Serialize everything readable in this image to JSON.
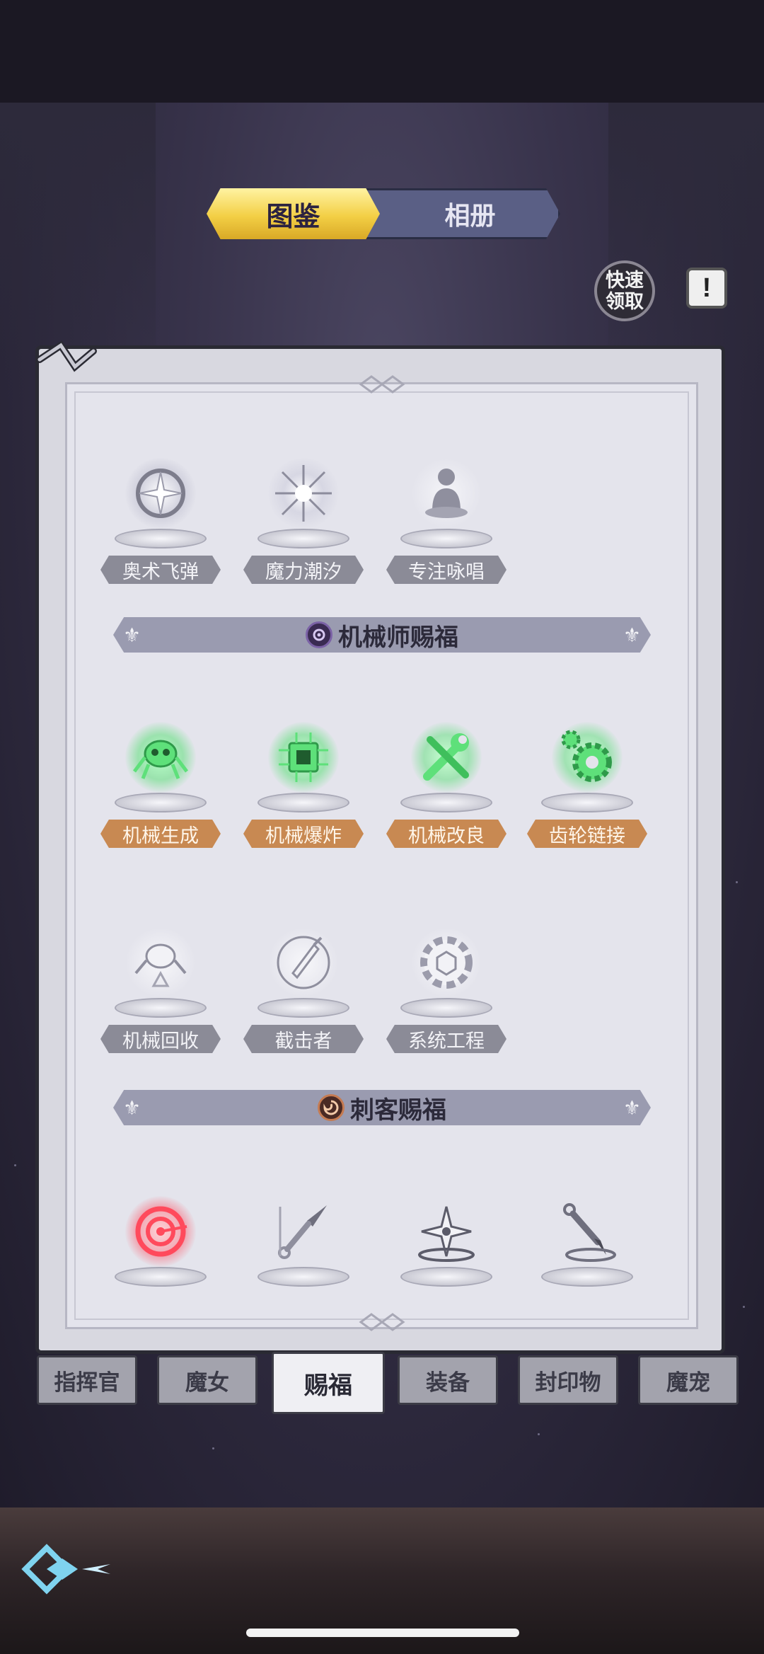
{
  "top_tabs": {
    "active": "图鉴",
    "inactive": "相册"
  },
  "quick_claim_label": "快速领取",
  "info_label": "!",
  "row1_items": [
    {
      "label": "奥术飞弹",
      "icon": "orb-sparkle-icon"
    },
    {
      "label": "魔力潮汐",
      "icon": "burst-icon"
    },
    {
      "label": "专注咏唱",
      "icon": "meditating-figure-icon"
    }
  ],
  "section_mechanic": {
    "title": "机械师赐福",
    "icon": "gear-emblem-icon"
  },
  "row2_items": [
    {
      "label": "机械生成",
      "icon": "mech-spider-icon"
    },
    {
      "label": "机械爆炸",
      "icon": "chip-icon"
    },
    {
      "label": "机械改良",
      "icon": "wrench-screwdriver-icon"
    },
    {
      "label": "齿轮链接",
      "icon": "gear-link-icon"
    }
  ],
  "row3_items": [
    {
      "label": "机械回收",
      "icon": "recycle-spider-icon"
    },
    {
      "label": "截击者",
      "icon": "drill-icon"
    },
    {
      "label": "系统工程",
      "icon": "gear-cube-icon"
    }
  ],
  "section_assassin": {
    "title": "刺客赐福",
    "icon": "swirl-emblem-icon"
  },
  "row4_items": [
    {
      "icon": "target-icon"
    },
    {
      "icon": "kunai-icon"
    },
    {
      "icon": "shuriken-icon"
    },
    {
      "icon": "dagger-splash-icon"
    }
  ],
  "bottom_tabs": [
    {
      "label": "指挥官",
      "active": false
    },
    {
      "label": "魔女",
      "active": false
    },
    {
      "label": "赐福",
      "active": true
    },
    {
      "label": "装备",
      "active": false
    },
    {
      "label": "封印物",
      "active": false
    },
    {
      "label": "魔宠",
      "active": false
    }
  ],
  "colors": {
    "active_tab": "#f3cf45",
    "orange_label": "#c88952",
    "grey_label": "#8b8b97",
    "green_glow": "#5ee07a",
    "red_glow": "#ff4a5c"
  }
}
